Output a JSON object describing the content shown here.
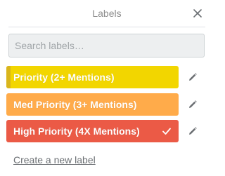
{
  "popover": {
    "title": "Labels",
    "close_icon": "close-icon"
  },
  "search": {
    "placeholder": "Search labels…",
    "value": ""
  },
  "labels": [
    {
      "text": "Priority (2+ Mentions)",
      "color": "#f2d600",
      "stripe_color": "#d9b51c",
      "selected": false
    },
    {
      "text": "Med Priority (3+ Mentions)",
      "color": "#ffab4a",
      "selected": false
    },
    {
      "text": "High Priority (4X Mentions)",
      "color": "#eb5a46",
      "selected": true
    }
  ],
  "icons": {
    "edit": "pencil-icon",
    "selected": "check-icon"
  },
  "footer": {
    "create_label": "Create a new label"
  }
}
